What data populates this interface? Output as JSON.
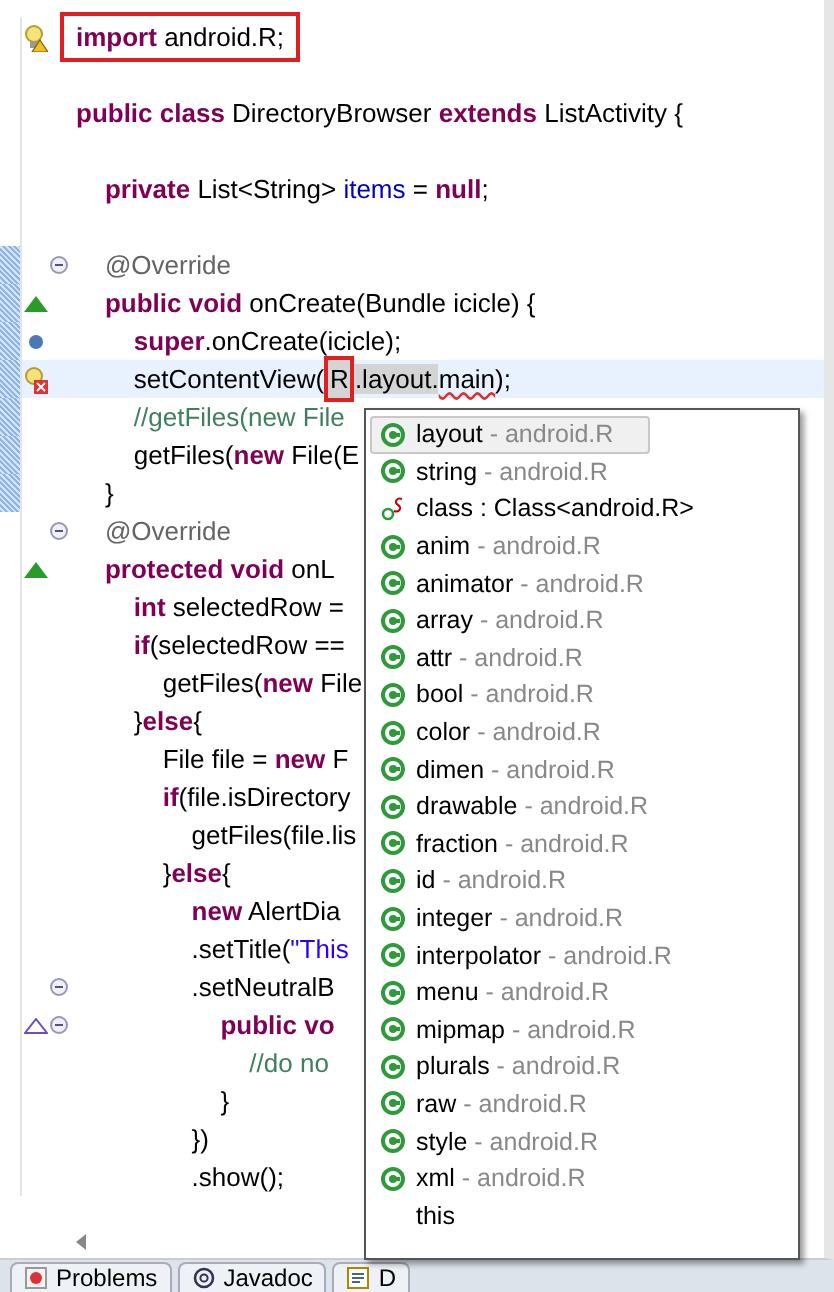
{
  "editor": {
    "lines": [
      {
        "segments": [
          {
            "kind": "kw",
            "text": "import"
          },
          {
            "kind": "plain",
            "text": " android.R;"
          }
        ],
        "marker": {
          "kind": "warning"
        },
        "foldable": false,
        "changed": false,
        "boxed": true
      },
      {
        "foldable": false,
        "changed": false
      },
      {
        "segments": [
          {
            "kind": "kw",
            "text": "public class"
          },
          {
            "kind": "plain",
            "text": " DirectoryBrowser "
          },
          {
            "kind": "kw",
            "text": "extends"
          },
          {
            "kind": "plain",
            "text": " ListActivity {"
          }
        ],
        "foldable": false,
        "changed": false,
        "boxed": false
      },
      {
        "foldable": false,
        "changed": false
      },
      {
        "segments": [
          {
            "kind": "kw",
            "text": "    private"
          },
          {
            "kind": "plain",
            "text": " List<String> "
          },
          {
            "kind": "field",
            "text": "items"
          },
          {
            "kind": "plain",
            "text": " = "
          },
          {
            "kind": "kw",
            "text": "null"
          },
          {
            "kind": "plain",
            "text": ";"
          }
        ],
        "foldable": false,
        "changed": false,
        "boxed": false
      },
      {
        "foldable": false,
        "changed": false
      },
      {
        "segments": [
          {
            "kind": "annot",
            "text": "    @Override"
          }
        ],
        "foldable": true,
        "changed": true,
        "boxed": false
      },
      {
        "segments": [
          {
            "kind": "kw",
            "text": "    public void"
          },
          {
            "kind": "plain",
            "text": " onCreate(Bundle icicle) {"
          }
        ],
        "marker": {
          "kind": "override"
        },
        "foldable": false,
        "changed": true,
        "boxed": false
      },
      {
        "segments": [
          {
            "kind": "kw",
            "text": "        super"
          },
          {
            "kind": "plain",
            "text": ".onCreate(icicle);"
          }
        ],
        "marker": {
          "kind": "circle"
        },
        "foldable": false,
        "changed": true,
        "boxed": false
      },
      {
        "segments": [
          {
            "kind": "plain",
            "text": "        setContentView("
          },
          {
            "kind": "mark",
            "text": "R"
          },
          {
            "kind": "sel",
            "text": ".layout."
          },
          {
            "kind": "err",
            "text": "main"
          },
          {
            "kind": "plain",
            "text": ");"
          }
        ],
        "marker": {
          "kind": "error"
        },
        "foldable": false,
        "changed": true,
        "boxed": false,
        "current": true
      },
      {
        "segments": [
          {
            "kind": "comment",
            "text": "        //getFiles(new File"
          }
        ],
        "foldable": false,
        "changed": true,
        "boxed": false
      },
      {
        "segments": [
          {
            "kind": "plain",
            "text": "        getFiles("
          },
          {
            "kind": "kw",
            "text": "new"
          },
          {
            "kind": "plain",
            "text": " File(E"
          }
        ],
        "foldable": false,
        "changed": true,
        "boxed": false
      },
      {
        "segments": [
          {
            "kind": "plain",
            "text": "    }"
          }
        ],
        "foldable": false,
        "changed": true,
        "boxed": false
      },
      {
        "segments": [
          {
            "kind": "annot",
            "text": "    @Override"
          }
        ],
        "foldable": true,
        "changed": false,
        "boxed": false
      },
      {
        "segments": [
          {
            "kind": "kw",
            "text": "    protected void"
          },
          {
            "kind": "plain",
            "text": " onL"
          }
        ],
        "marker": {
          "kind": "override"
        },
        "foldable": false,
        "changed": false,
        "boxed": false
      },
      {
        "segments": [
          {
            "kind": "kw",
            "text": "        int"
          },
          {
            "kind": "plain",
            "text": " selectedRow ="
          }
        ],
        "foldable": false,
        "changed": false,
        "boxed": false
      },
      {
        "segments": [
          {
            "kind": "kw",
            "text": "        if"
          },
          {
            "kind": "plain",
            "text": "(selectedRow =="
          }
        ],
        "foldable": false,
        "changed": false,
        "boxed": false
      },
      {
        "segments": [
          {
            "kind": "plain",
            "text": "            getFiles("
          },
          {
            "kind": "kw",
            "text": "new"
          },
          {
            "kind": "plain",
            "text": " File"
          }
        ],
        "foldable": false,
        "changed": false,
        "boxed": false
      },
      {
        "segments": [
          {
            "kind": "plain",
            "text": "        }"
          },
          {
            "kind": "kw",
            "text": "else"
          },
          {
            "kind": "plain",
            "text": "{"
          }
        ],
        "foldable": false,
        "changed": false,
        "boxed": false
      },
      {
        "segments": [
          {
            "kind": "plain",
            "text": "            File file = "
          },
          {
            "kind": "kw",
            "text": "new"
          },
          {
            "kind": "plain",
            "text": " F"
          }
        ],
        "foldable": false,
        "changed": false,
        "boxed": false
      },
      {
        "segments": [
          {
            "kind": "kw",
            "text": "            if"
          },
          {
            "kind": "plain",
            "text": "(file.isDirectory"
          }
        ],
        "foldable": false,
        "changed": false,
        "boxed": false
      },
      {
        "segments": [
          {
            "kind": "plain",
            "text": "                getFiles(file.lis"
          }
        ],
        "foldable": false,
        "changed": false,
        "boxed": false
      },
      {
        "segments": [
          {
            "kind": "plain",
            "text": "            }"
          },
          {
            "kind": "kw",
            "text": "else"
          },
          {
            "kind": "plain",
            "text": "{"
          }
        ],
        "foldable": false,
        "changed": false,
        "boxed": false
      },
      {
        "segments": [
          {
            "kind": "kw",
            "text": "                new"
          },
          {
            "kind": "plain",
            "text": " AlertDia"
          }
        ],
        "foldable": false,
        "changed": false,
        "boxed": false
      },
      {
        "segments": [
          {
            "kind": "plain",
            "text": "                .setTitle("
          },
          {
            "kind": "str",
            "text": "\"This"
          }
        ],
        "foldable": false,
        "changed": false,
        "boxed": false
      },
      {
        "segments": [
          {
            "kind": "plain",
            "text": "                .setNeutralB"
          }
        ],
        "foldable": true,
        "changed": false,
        "boxed": false
      },
      {
        "segments": [
          {
            "kind": "kw",
            "text": "                    public vo"
          }
        ],
        "marker": {
          "kind": "implement"
        },
        "foldable": true,
        "changed": false,
        "boxed": false
      },
      {
        "segments": [
          {
            "kind": "comment",
            "text": "                        //do no"
          }
        ],
        "foldable": false,
        "changed": false,
        "boxed": false
      },
      {
        "segments": [
          {
            "kind": "plain",
            "text": "                    }"
          }
        ],
        "foldable": false,
        "changed": false,
        "boxed": false
      },
      {
        "segments": [
          {
            "kind": "plain",
            "text": "                })"
          }
        ],
        "foldable": false,
        "changed": false,
        "boxed": false
      },
      {
        "segments": [
          {
            "kind": "plain",
            "text": "                .show();"
          }
        ],
        "foldable": false,
        "changed": false,
        "boxed": false
      }
    ]
  },
  "completion": {
    "items": [
      {
        "kind": "class",
        "name": "layout",
        "detail": " - android.R",
        "selected": true
      },
      {
        "kind": "class",
        "name": "string",
        "detail": " - android.R",
        "selected": false
      },
      {
        "kind": "static-field",
        "name": "class : Class<android.R>",
        "selected": false
      },
      {
        "kind": "class",
        "name": "anim",
        "detail": " - android.R",
        "selected": false
      },
      {
        "kind": "class",
        "name": "animator",
        "detail": " - android.R",
        "selected": false
      },
      {
        "kind": "class",
        "name": "array",
        "detail": " - android.R",
        "selected": false
      },
      {
        "kind": "class",
        "name": "attr",
        "detail": " - android.R",
        "selected": false
      },
      {
        "kind": "class",
        "name": "bool",
        "detail": " - android.R",
        "selected": false
      },
      {
        "kind": "class",
        "name": "color",
        "detail": " - android.R",
        "selected": false
      },
      {
        "kind": "class",
        "name": "dimen",
        "detail": " - android.R",
        "selected": false
      },
      {
        "kind": "class",
        "name": "drawable",
        "detail": " - android.R",
        "selected": false
      },
      {
        "kind": "class",
        "name": "fraction",
        "detail": " - android.R",
        "selected": false
      },
      {
        "kind": "class",
        "name": "id",
        "detail": " - android.R",
        "selected": false
      },
      {
        "kind": "class",
        "name": "integer",
        "detail": " - android.R",
        "selected": false
      },
      {
        "kind": "class",
        "name": "interpolator",
        "detail": " - android.R",
        "selected": false
      },
      {
        "kind": "class",
        "name": "menu",
        "detail": " - android.R",
        "selected": false
      },
      {
        "kind": "class",
        "name": "mipmap",
        "detail": " - android.R",
        "selected": false
      },
      {
        "kind": "class",
        "name": "plurals",
        "detail": " - android.R",
        "selected": false
      },
      {
        "kind": "class",
        "name": "raw",
        "detail": " - android.R",
        "selected": false
      },
      {
        "kind": "class",
        "name": "style",
        "detail": " - android.R",
        "selected": false
      },
      {
        "kind": "class",
        "name": "xml",
        "detail": " - android.R",
        "selected": false
      },
      {
        "name": "this",
        "selected": false
      }
    ]
  },
  "bottom_tabs": [
    {
      "kind": "problems",
      "label": "Problems"
    },
    {
      "kind": "at",
      "label": "Javadoc"
    },
    {
      "kind": "declaration",
      "label": "D"
    }
  ]
}
